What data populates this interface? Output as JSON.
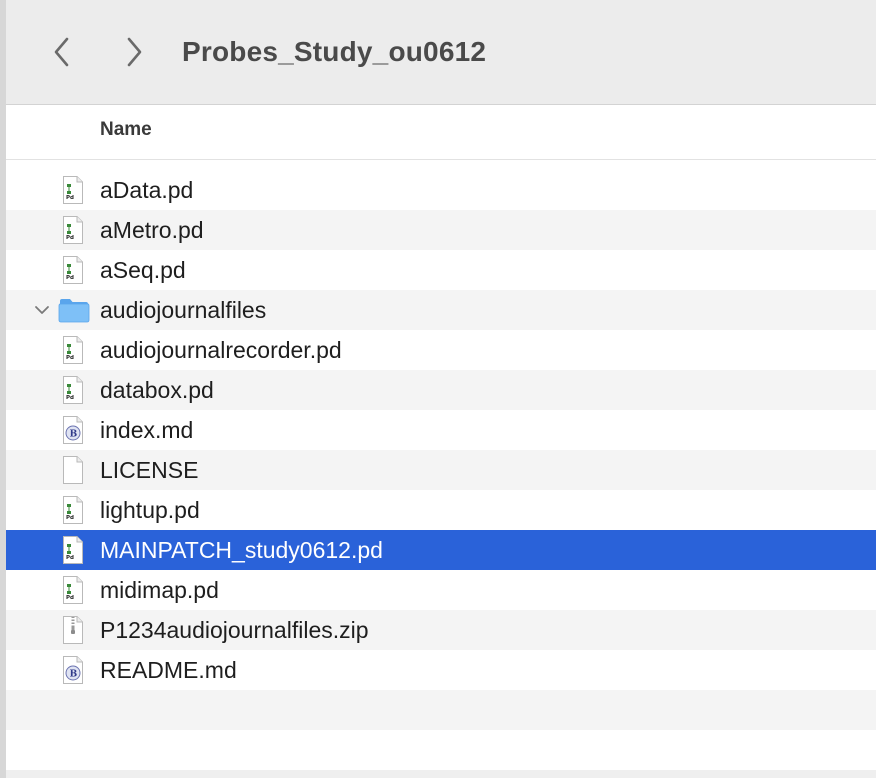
{
  "window": {
    "title": "Probes_Study_ou0612"
  },
  "toolbar": {
    "back_icon": "chevron-left-icon",
    "forward_icon": "chevron-right-icon"
  },
  "column_header": {
    "name_label": "Name"
  },
  "files": [
    {
      "name": "aData.pd",
      "icon": "pd-file-icon",
      "selected": false
    },
    {
      "name": "aMetro.pd",
      "icon": "pd-file-icon",
      "selected": false
    },
    {
      "name": "aSeq.pd",
      "icon": "pd-file-icon",
      "selected": false
    },
    {
      "name": "audiojournalfiles",
      "icon": "folder-icon",
      "expanded": true,
      "selected": false
    },
    {
      "name": "audiojournalrecorder.pd",
      "icon": "pd-file-icon",
      "selected": false
    },
    {
      "name": "databox.pd",
      "icon": "pd-file-icon",
      "selected": false
    },
    {
      "name": "index.md",
      "icon": "markdown-file-icon",
      "selected": false
    },
    {
      "name": "LICENSE",
      "icon": "blank-file-icon",
      "selected": false
    },
    {
      "name": "lightup.pd",
      "icon": "pd-file-icon",
      "selected": false
    },
    {
      "name": "MAINPATCH_study0612.pd",
      "icon": "pd-file-icon",
      "selected": true
    },
    {
      "name": "midimap.pd",
      "icon": "pd-file-icon",
      "selected": false
    },
    {
      "name": "P1234audiojournalfiles.zip",
      "icon": "zip-file-icon",
      "selected": false
    },
    {
      "name": "README.md",
      "icon": "markdown-file-icon",
      "selected": false
    }
  ],
  "colors": {
    "selection": "#2a62d9",
    "folder": "#6db3f2",
    "stripe": "#f4f4f4"
  }
}
